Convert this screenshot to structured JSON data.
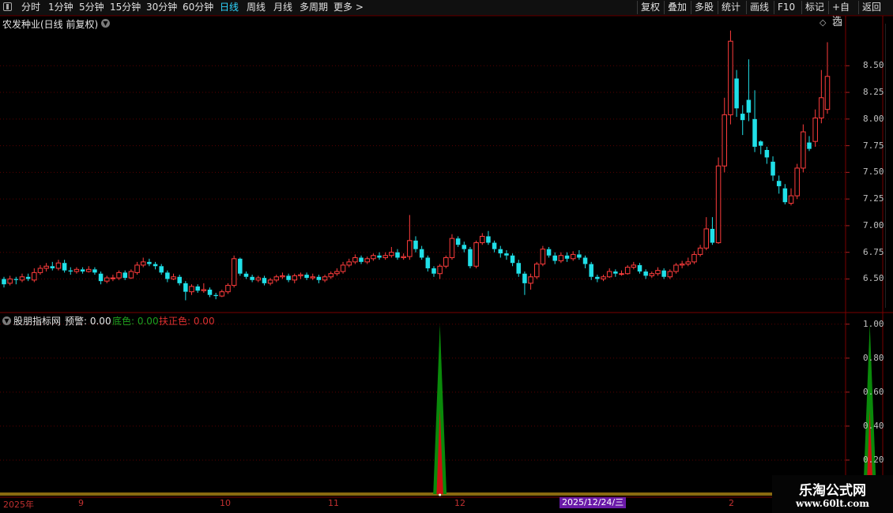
{
  "toolbar": {
    "periods": [
      "分时",
      "1分钟",
      "5分钟",
      "15分钟",
      "30分钟",
      "60分钟",
      "日线",
      "周线",
      "月线",
      "多周期",
      "更多 >"
    ],
    "active_period": "日线",
    "right_buttons": [
      "复权",
      "叠加",
      "多股",
      "统计",
      "画线",
      "F10",
      "标记",
      "+自选",
      "返回"
    ]
  },
  "stock_title": "农发种业(日线 前复权)",
  "price_axis": [
    "8.50",
    "8.25",
    "8.00",
    "7.75",
    "7.50",
    "7.25",
    "7.00",
    "6.75",
    "6.50"
  ],
  "indicator": {
    "name": "股朋指标网",
    "warn_label": "预警: 0.00",
    "bottom_label": "底色: 0.00",
    "up_label": "扶正色: 0.00"
  },
  "indicator_axis": [
    "1.00",
    "0.80",
    "0.60",
    "0.40",
    "0.20"
  ],
  "dates": [
    "2025年",
    "9",
    "10",
    "11",
    "12",
    "2"
  ],
  "cursor_date": "2025/12/24/三",
  "watermark": {
    "title": "乐淘公式网",
    "url": "www.60lt.com"
  },
  "colors": {
    "up": "#ff3c3c",
    "down": "#20e0e8",
    "active": "#2fd6ff",
    "green": "#0a8a0a",
    "red": "#cc1010"
  },
  "chart_data": {
    "type": "candlestick",
    "ylim": [
      6.2,
      8.85
    ],
    "indicator_ylim": [
      0,
      1.05
    ],
    "candles": [
      [
        6.5,
        6.45,
        6.52,
        6.42
      ],
      [
        6.46,
        6.5,
        6.53,
        6.44
      ],
      [
        6.5,
        6.49,
        6.52,
        6.45
      ],
      [
        6.49,
        6.52,
        6.55,
        6.47
      ],
      [
        6.52,
        6.5,
        6.55,
        6.48
      ],
      [
        6.49,
        6.56,
        6.6,
        6.47
      ],
      [
        6.56,
        6.6,
        6.63,
        6.54
      ],
      [
        6.6,
        6.62,
        6.65,
        6.57
      ],
      [
        6.62,
        6.6,
        6.66,
        6.58
      ],
      [
        6.6,
        6.65,
        6.68,
        6.58
      ],
      [
        6.65,
        6.58,
        6.68,
        6.56
      ],
      [
        6.58,
        6.57,
        6.61,
        6.54
      ],
      [
        6.57,
        6.59,
        6.61,
        6.55
      ],
      [
        6.59,
        6.57,
        6.61,
        6.55
      ],
      [
        6.57,
        6.59,
        6.62,
        6.56
      ],
      [
        6.59,
        6.56,
        6.61,
        6.54
      ],
      [
        6.55,
        6.48,
        6.57,
        6.45
      ],
      [
        6.48,
        6.51,
        6.53,
        6.46
      ],
      [
        6.51,
        6.51,
        6.54,
        6.48
      ],
      [
        6.51,
        6.56,
        6.58,
        6.49
      ],
      [
        6.56,
        6.51,
        6.58,
        6.49
      ],
      [
        6.51,
        6.57,
        6.59,
        6.5
      ],
      [
        6.56,
        6.63,
        6.66,
        6.54
      ],
      [
        6.63,
        6.66,
        6.7,
        6.61
      ],
      [
        6.66,
        6.64,
        6.69,
        6.62
      ],
      [
        6.64,
        6.62,
        6.66,
        6.59
      ],
      [
        6.62,
        6.56,
        6.64,
        6.54
      ],
      [
        6.56,
        6.5,
        6.58,
        6.47
      ],
      [
        6.5,
        6.52,
        6.55,
        6.49
      ],
      [
        6.52,
        6.46,
        6.54,
        6.44
      ],
      [
        6.46,
        6.38,
        6.48,
        6.3
      ],
      [
        6.38,
        6.43,
        6.45,
        6.35
      ],
      [
        6.43,
        6.39,
        6.45,
        6.37
      ],
      [
        6.39,
        6.4,
        6.46,
        6.37
      ],
      [
        6.4,
        6.35,
        6.42,
        6.33
      ],
      [
        6.35,
        6.34,
        6.37,
        6.31
      ],
      [
        6.34,
        6.38,
        6.4,
        6.33
      ],
      [
        6.38,
        6.44,
        6.46,
        6.36
      ],
      [
        6.44,
        6.69,
        6.72,
        6.42
      ],
      [
        6.69,
        6.55,
        6.7,
        6.53
      ],
      [
        6.55,
        6.52,
        6.57,
        6.5
      ],
      [
        6.52,
        6.49,
        6.54,
        6.47
      ],
      [
        6.49,
        6.51,
        6.53,
        6.47
      ],
      [
        6.51,
        6.46,
        6.53,
        6.44
      ],
      [
        6.46,
        6.49,
        6.51,
        6.44
      ],
      [
        6.49,
        6.52,
        6.54,
        6.47
      ],
      [
        6.52,
        6.53,
        6.56,
        6.5
      ],
      [
        6.53,
        6.49,
        6.55,
        6.47
      ],
      [
        6.49,
        6.53,
        6.55,
        6.46
      ],
      [
        6.53,
        6.54,
        6.56,
        6.5
      ],
      [
        6.54,
        6.51,
        6.56,
        6.49
      ],
      [
        6.51,
        6.52,
        6.55,
        6.49
      ],
      [
        6.52,
        6.49,
        6.54,
        6.46
      ],
      [
        6.49,
        6.52,
        6.54,
        6.47
      ],
      [
        6.52,
        6.55,
        6.57,
        6.5
      ],
      [
        6.55,
        6.57,
        6.6,
        6.53
      ],
      [
        6.57,
        6.63,
        6.66,
        6.55
      ],
      [
        6.63,
        6.66,
        6.69,
        6.61
      ],
      [
        6.66,
        6.7,
        6.73,
        6.64
      ],
      [
        6.7,
        6.66,
        6.72,
        6.64
      ],
      [
        6.66,
        6.69,
        6.71,
        6.64
      ],
      [
        6.69,
        6.72,
        6.74,
        6.67
      ],
      [
        6.72,
        6.7,
        6.75,
        6.68
      ],
      [
        6.7,
        6.72,
        6.75,
        6.68
      ],
      [
        6.72,
        6.75,
        6.8,
        6.7
      ],
      [
        6.75,
        6.7,
        6.78,
        6.68
      ],
      [
        6.7,
        6.71,
        6.74,
        6.68
      ],
      [
        6.71,
        6.86,
        7.1,
        6.68
      ],
      [
        6.86,
        6.78,
        6.9,
        6.75
      ],
      [
        6.78,
        6.7,
        6.81,
        6.68
      ],
      [
        6.7,
        6.6,
        6.72,
        6.57
      ],
      [
        6.6,
        6.55,
        6.62,
        6.52
      ],
      [
        6.55,
        6.62,
        6.64,
        6.5
      ],
      [
        6.62,
        6.7,
        6.72,
        6.6
      ],
      [
        6.7,
        6.88,
        6.92,
        6.68
      ],
      [
        6.88,
        6.82,
        6.9,
        6.8
      ],
      [
        6.82,
        6.78,
        6.85,
        6.75
      ],
      [
        6.78,
        6.62,
        6.8,
        6.6
      ],
      [
        6.62,
        6.84,
        6.86,
        6.6
      ],
      [
        6.84,
        6.9,
        6.93,
        6.82
      ],
      [
        6.9,
        6.84,
        6.95,
        6.82
      ],
      [
        6.84,
        6.78,
        6.86,
        6.75
      ],
      [
        6.78,
        6.74,
        6.81,
        6.7
      ],
      [
        6.74,
        6.72,
        6.77,
        6.68
      ],
      [
        6.72,
        6.65,
        6.74,
        6.62
      ],
      [
        6.65,
        6.55,
        6.68,
        6.52
      ],
      [
        6.55,
        6.46,
        6.57,
        6.35
      ],
      [
        6.46,
        6.52,
        6.55,
        6.4
      ],
      [
        6.52,
        6.64,
        6.66,
        6.5
      ],
      [
        6.64,
        6.78,
        6.81,
        6.62
      ],
      [
        6.78,
        6.72,
        6.8,
        6.7
      ],
      [
        6.72,
        6.67,
        6.75,
        6.64
      ],
      [
        6.67,
        6.72,
        6.75,
        6.65
      ],
      [
        6.72,
        6.69,
        6.75,
        6.66
      ],
      [
        6.69,
        6.73,
        6.76,
        6.67
      ],
      [
        6.73,
        6.7,
        6.77,
        6.68
      ],
      [
        6.7,
        6.64,
        6.72,
        6.6
      ],
      [
        6.64,
        6.52,
        6.66,
        6.49
      ],
      [
        6.52,
        6.5,
        6.54,
        6.47
      ],
      [
        6.5,
        6.52,
        6.54,
        6.48
      ],
      [
        6.52,
        6.57,
        6.6,
        6.51
      ],
      [
        6.57,
        6.55,
        6.59,
        6.52
      ],
      [
        6.55,
        6.55,
        6.58,
        6.53
      ],
      [
        6.55,
        6.61,
        6.63,
        6.54
      ],
      [
        6.61,
        6.63,
        6.66,
        6.59
      ],
      [
        6.63,
        6.57,
        6.65,
        6.55
      ],
      [
        6.57,
        6.53,
        6.59,
        6.5
      ],
      [
        6.53,
        6.55,
        6.57,
        6.51
      ],
      [
        6.55,
        6.58,
        6.61,
        6.53
      ],
      [
        6.58,
        6.52,
        6.6,
        6.5
      ],
      [
        6.52,
        6.57,
        6.59,
        6.5
      ],
      [
        6.57,
        6.63,
        6.65,
        6.55
      ],
      [
        6.63,
        6.64,
        6.67,
        6.6
      ],
      [
        6.64,
        6.66,
        6.7,
        6.62
      ],
      [
        6.66,
        6.73,
        6.76,
        6.64
      ],
      [
        6.73,
        6.79,
        6.82,
        6.71
      ],
      [
        6.79,
        6.97,
        7.08,
        6.77
      ],
      [
        6.97,
        6.84,
        7.08,
        6.82
      ],
      [
        6.84,
        7.56,
        7.64,
        6.83
      ],
      [
        7.56,
        8.04,
        8.2,
        7.5
      ],
      [
        8.04,
        8.73,
        8.83,
        7.95
      ],
      [
        8.38,
        8.1,
        8.46,
        8.02
      ],
      [
        8.05,
        7.99,
        8.13,
        7.85
      ],
      [
        8.18,
        8.06,
        8.56,
        7.98
      ],
      [
        8.0,
        7.74,
        8.27,
        7.69
      ],
      [
        7.79,
        7.75,
        7.8,
        7.67
      ],
      [
        7.71,
        7.64,
        7.74,
        7.58
      ],
      [
        7.6,
        7.47,
        7.65,
        7.42
      ],
      [
        7.42,
        7.37,
        7.47,
        7.3
      ],
      [
        7.35,
        7.22,
        7.39,
        7.2
      ],
      [
        7.21,
        7.28,
        7.35,
        7.19
      ],
      [
        7.28,
        7.54,
        7.58,
        7.25
      ],
      [
        7.54,
        7.88,
        7.95,
        7.5
      ],
      [
        7.78,
        7.72,
        7.84,
        7.7
      ],
      [
        7.79,
        8.01,
        8.09,
        7.74
      ],
      [
        8.01,
        8.2,
        8.46,
        7.96
      ],
      [
        8.09,
        8.4,
        8.72,
        8.05
      ]
    ],
    "indicator_peaks": [
      {
        "index": 72,
        "bottom": 1.0,
        "up": 0.5
      },
      {
        "index": 143,
        "bottom": 1.0,
        "up": 0.5
      }
    ]
  }
}
